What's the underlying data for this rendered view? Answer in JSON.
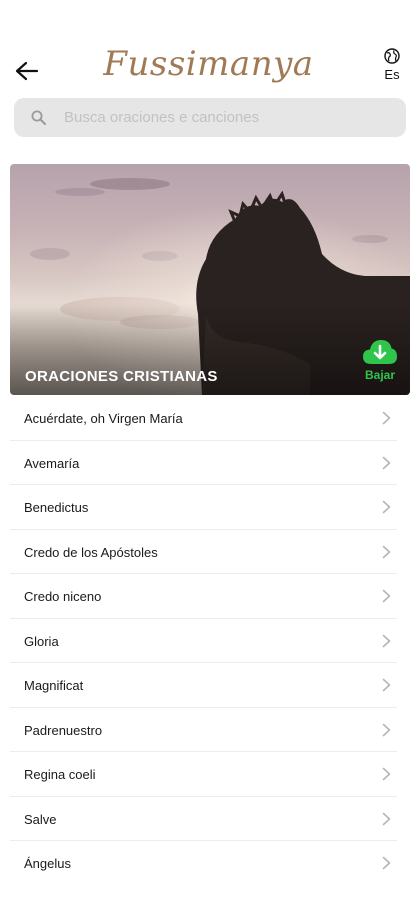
{
  "header": {
    "logo_text": "Fussimanya",
    "language_label": "Es",
    "icons": {
      "back": "arrow-left-icon",
      "language": "globe-icon"
    }
  },
  "search": {
    "placeholder": "Busca oraciones e canciones",
    "value": "",
    "icon": "search-icon"
  },
  "hero": {
    "title": "ORACIONES CRISTIANAS",
    "download_label": "Bajar",
    "download_icon": "cloud-download-icon",
    "accent_color": "#2fc44a"
  },
  "list": {
    "items": [
      "Acuérdate, oh Virgen María",
      "Avemaría",
      "Benedictus",
      "Credo de los Apóstoles",
      "Credo niceno",
      "Gloria",
      "Magnificat",
      "Padrenuestro",
      "Regina coeli",
      "Salve",
      "Ángelus"
    ],
    "item_icon": "chevron-right-icon"
  }
}
